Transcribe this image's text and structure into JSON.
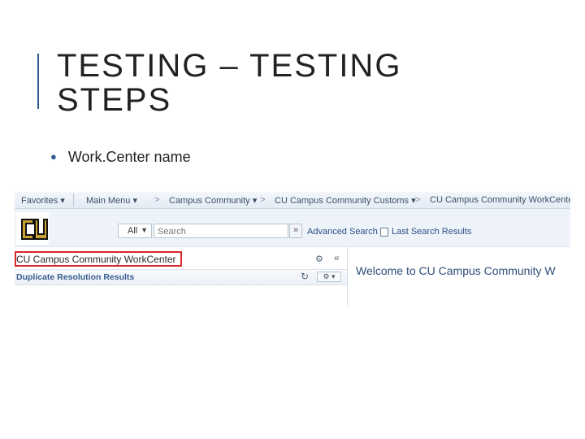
{
  "slide": {
    "title_line1": "TESTING – TESTING",
    "title_line2": "STEPS",
    "bullets": [
      "Work.Center name"
    ]
  },
  "screenshot": {
    "nav": {
      "favorites": "Favorites ▾",
      "main_menu": "Main Menu ▾",
      "separator": ">",
      "campus_community": "Campus Community ▾",
      "cu_customs": "CU Campus Community Customs ▾",
      "workcenter": "CU Campus Community WorkCenter"
    },
    "search": {
      "scope_value": "All",
      "placeholder": "Search",
      "go_label": "»",
      "advanced_search": "Advanced Search",
      "last_results": "Last Search Results"
    },
    "workcenter": {
      "title": "CU Campus Community WorkCenter",
      "panel_title": "Duplicate Resolution Results",
      "gear_icon": "⚙",
      "collapse_icon": "«",
      "refresh_icon": "↻",
      "options_label": "⚙ ▾"
    },
    "welcome_text": "Welcome to CU Campus Community W"
  },
  "colors": {
    "accent": "#2e5a8c",
    "highlight": "#d7262c",
    "logo_gold": "#c9a233",
    "link": "#2a4e83"
  }
}
